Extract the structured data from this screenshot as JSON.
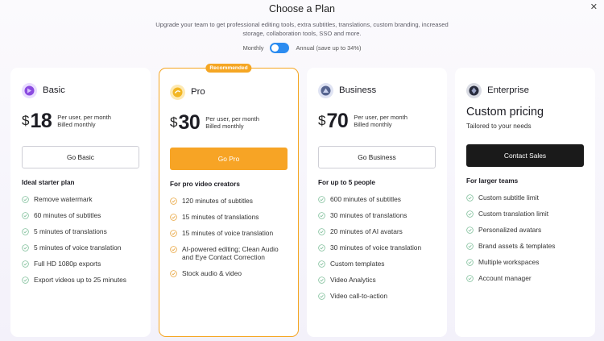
{
  "header": {
    "title": "Choose a Plan",
    "subtitle": "Upgrade your team to get professional editing tools, extra subtitles, translations, custom branding, increased storage, collaboration tools, SSO and more.",
    "close_label": "✕"
  },
  "billing": {
    "monthly_label": "Monthly",
    "annual_label": "Annual (save up to 34%)"
  },
  "colors": {
    "accent_orange": "#f7a425",
    "toggle_blue": "#2c8cf0",
    "check_green": "#7fbf9a",
    "check_orange": "#e8a33a",
    "dark_button": "#1a1a1a"
  },
  "plans": [
    {
      "name": "Basic",
      "icon": "basic-plan-icon",
      "currency": "$",
      "price": "18",
      "note_line1": "Per user, per month",
      "note_line2": "Billed monthly",
      "cta": "Go Basic",
      "tagline": "Ideal starter plan",
      "features": [
        "Remove watermark",
        "60 minutes of subtitles",
        "5 minutes of translations",
        "5 minutes of voice translation",
        "Full HD 1080p exports",
        "Export videos up to 25 minutes"
      ]
    },
    {
      "name": "Pro",
      "icon": "pro-plan-icon",
      "badge": "Recommended",
      "currency": "$",
      "price": "30",
      "note_line1": "Per user, per month",
      "note_line2": "Billed monthly",
      "cta": "Go Pro",
      "tagline": "For pro video creators",
      "features": [
        "120 minutes of subtitles",
        "15 minutes of translations",
        "15 minutes of voice translation",
        "AI-powered editing; Clean Audio and Eye Contact Correction",
        "Stock audio & video"
      ]
    },
    {
      "name": "Business",
      "icon": "business-plan-icon",
      "currency": "$",
      "price": "70",
      "note_line1": "Per user, per month",
      "note_line2": "Billed monthly",
      "cta": "Go Business",
      "tagline": "For up to 5 people",
      "features": [
        "600 minutes of subtitles",
        "30 minutes of translations",
        "20 minutes of AI avatars",
        "30 minutes of voice translation",
        "Custom templates",
        "Video Analytics",
        "Video call-to-action"
      ]
    },
    {
      "name": "Enterprise",
      "icon": "enterprise-plan-icon",
      "custom_title": "Custom pricing",
      "custom_sub": "Tailored to your needs",
      "cta": "Contact Sales",
      "tagline": "For larger teams",
      "features": [
        "Custom subtitle limit",
        "Custom translation limit",
        "Personalized avatars",
        "Brand assets & templates",
        "Multiple workspaces",
        "Account manager"
      ]
    }
  ]
}
